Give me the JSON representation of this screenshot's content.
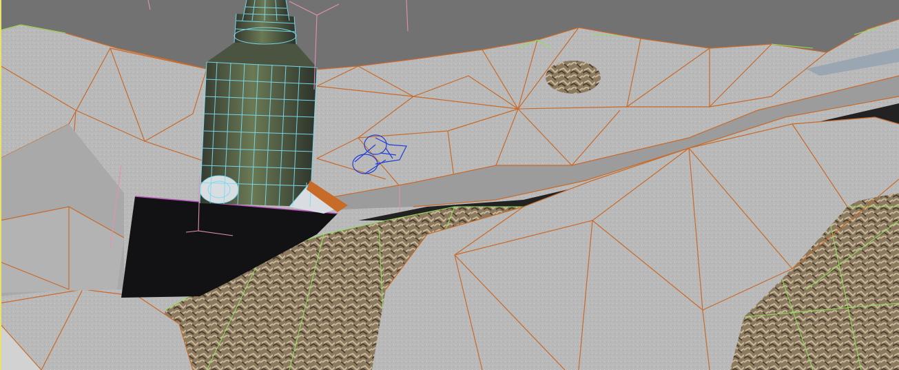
{
  "viewport": {
    "label": "",
    "mode": "perspective",
    "display_style": "textured-with-edged-faces"
  },
  "colors": {
    "background": "#727272",
    "terrain_surface": "#b9b9b9",
    "terrain_shadow": "#8f8f8f",
    "terrain_edge_wire": "#c86a28",
    "rock_wire": "#8fe05a",
    "rock_texture": "#8b7960",
    "tower_wire": "#79dcef",
    "tower_body": "#5a6a4a",
    "camera_wire": "#1f3cd8",
    "helper_wire": "#e58fb4",
    "void_plane": "#111114"
  },
  "objects": [
    {
      "name": "terrain-mesh",
      "kind": "editable-mesh"
    },
    {
      "name": "rock-cliff",
      "kind": "editable-mesh"
    },
    {
      "name": "tower-silo",
      "kind": "wireframe-geometry"
    },
    {
      "name": "camera-gizmo",
      "kind": "camera-helper"
    },
    {
      "name": "pivot-axis-helper",
      "kind": "helper"
    },
    {
      "name": "black-plane",
      "kind": "plane"
    }
  ]
}
